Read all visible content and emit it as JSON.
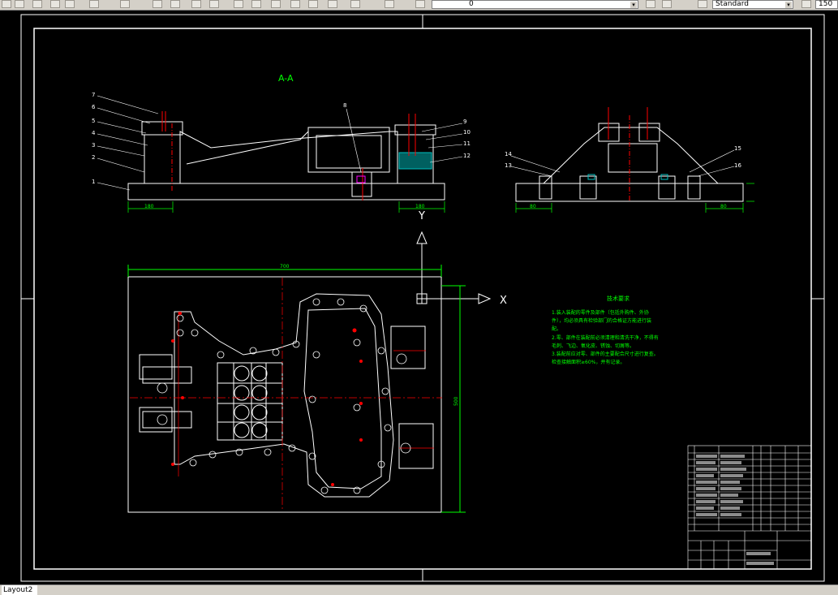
{
  "toolbar": {
    "layer_value": "0",
    "style_value": "Standard",
    "scale_value": "150"
  },
  "drawing": {
    "section_label": "A-A",
    "dim_left_front": "180",
    "dim_right_front": "180",
    "dim_side_left": "80",
    "dim_side_right": "80",
    "dim_width_top": "700",
    "dim_height_right": "500",
    "axis_y": "Y",
    "axis_x": "X",
    "callouts_left": [
      "7",
      "6",
      "5",
      "4",
      "3",
      "2",
      "1"
    ],
    "callouts_mid": [
      "8"
    ],
    "callouts_right": [
      "9",
      "10",
      "11",
      "12"
    ],
    "callouts_side": [
      "14",
      "13",
      "15",
      "16"
    ],
    "notes_title": "技术要求",
    "notes_lines": [
      "1.装入装配的零件及部件（包括外购件、外协",
      "件），均必须具有检验部门的合格证方能进行装",
      "配。",
      "2.零、部件在装配前必须清理和清洗干净，不得有",
      "毛刺、飞边、氧化皮、锈蚀、切屑等。",
      "3.装配前应对零、部件的主要配合尺寸进行复查。",
      "检查接触面积≥60%，并有记录。"
    ]
  },
  "colors": {
    "background": "#000000",
    "line_white": "#ffffff",
    "line_red": "#ff0000",
    "line_green": "#00ff00",
    "line_cyan": "#00c0c0",
    "line_magenta": "#ff00ff"
  },
  "status": {
    "layout_tab": "Layout2"
  }
}
